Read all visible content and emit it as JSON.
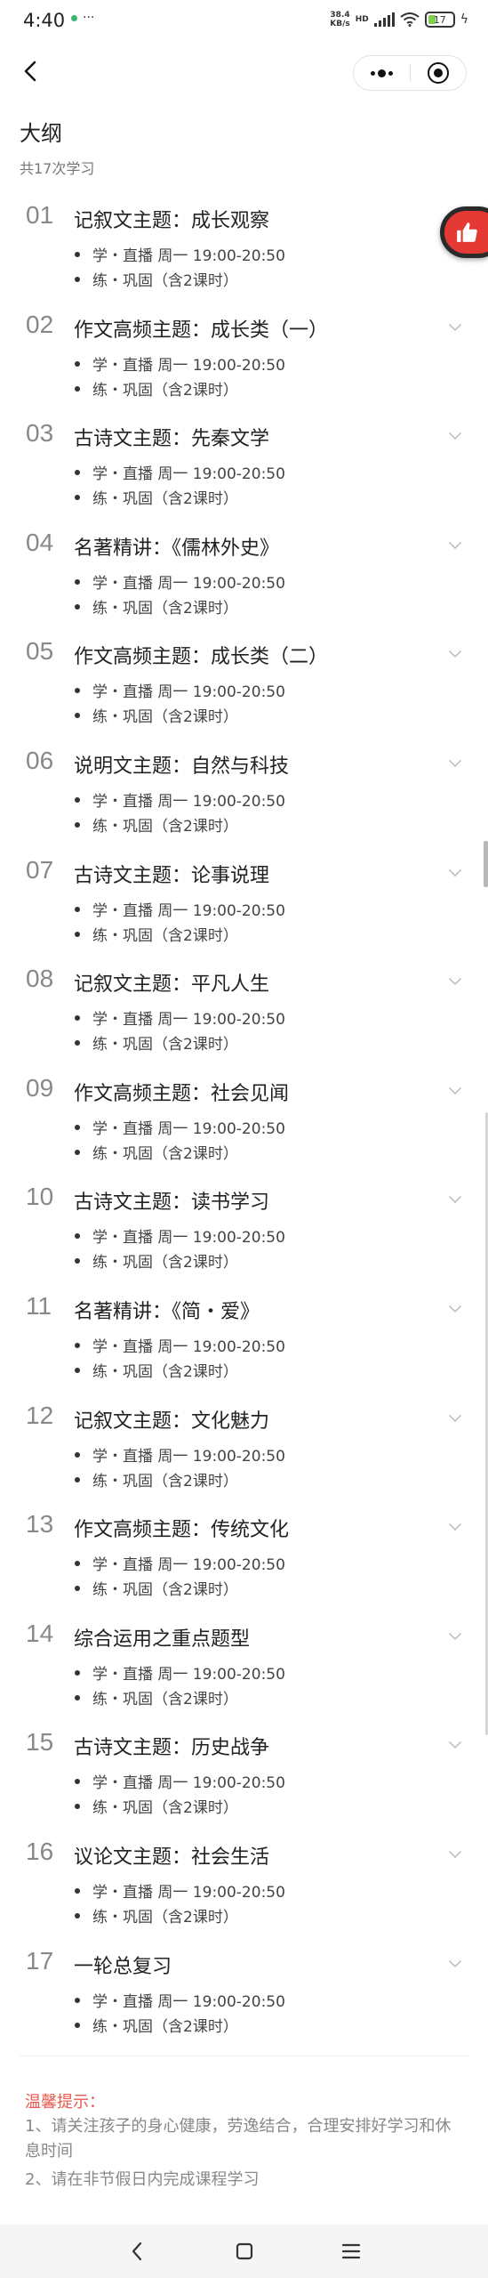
{
  "status_bar": {
    "time": "4:40",
    "extra": "···",
    "net_speed_top": "38.4",
    "net_speed_bottom": "KB/s",
    "net_type": "HD",
    "battery_level": "17"
  },
  "header": {
    "title": "大纲",
    "count": "共17次学习"
  },
  "outline": [
    {
      "num": "01",
      "title": "记叙文主题：成长观察",
      "sub1": "学・直播  周一 19:00-20:50",
      "sub2": "练・巩固（含2课时）"
    },
    {
      "num": "02",
      "title": "作文高频主题：成长类（一）",
      "sub1": "学・直播  周一 19:00-20:50",
      "sub2": "练・巩固（含2课时）"
    },
    {
      "num": "03",
      "title": "古诗文主题：先秦文学",
      "sub1": "学・直播  周一 19:00-20:50",
      "sub2": "练・巩固（含2课时）"
    },
    {
      "num": "04",
      "title": "名著精讲：《儒林外史》",
      "sub1": "学・直播  周一 19:00-20:50",
      "sub2": "练・巩固（含2课时）"
    },
    {
      "num": "05",
      "title": "作文高频主题：成长类（二）",
      "sub1": "学・直播  周一 19:00-20:50",
      "sub2": "练・巩固（含2课时）"
    },
    {
      "num": "06",
      "title": "说明文主题：自然与科技",
      "sub1": "学・直播  周一 19:00-20:50",
      "sub2": "练・巩固（含2课时）"
    },
    {
      "num": "07",
      "title": "古诗文主题：论事说理",
      "sub1": "学・直播  周一 19:00-20:50",
      "sub2": "练・巩固（含2课时）"
    },
    {
      "num": "08",
      "title": "记叙文主题：平凡人生",
      "sub1": "学・直播  周一 19:00-20:50",
      "sub2": "练・巩固（含2课时）"
    },
    {
      "num": "09",
      "title": "作文高频主题：社会见闻",
      "sub1": "学・直播  周一 19:00-20:50",
      "sub2": "练・巩固（含2课时）"
    },
    {
      "num": "10",
      "title": "古诗文主题：读书学习",
      "sub1": "学・直播  周一 19:00-20:50",
      "sub2": "练・巩固（含2课时）"
    },
    {
      "num": "11",
      "title": "名著精讲：《简・爱》",
      "sub1": "学・直播  周一 19:00-20:50",
      "sub2": "练・巩固（含2课时）"
    },
    {
      "num": "12",
      "title": "记叙文主题：文化魅力",
      "sub1": "学・直播  周一 19:00-20:50",
      "sub2": "练・巩固（含2课时）"
    },
    {
      "num": "13",
      "title": "作文高频主题：传统文化",
      "sub1": "学・直播  周一 19:00-20:50",
      "sub2": "练・巩固（含2课时）"
    },
    {
      "num": "14",
      "title": "综合运用之重点题型",
      "sub1": "学・直播  周一 19:00-20:50",
      "sub2": "练・巩固（含2课时）"
    },
    {
      "num": "15",
      "title": "古诗文主题：历史战争",
      "sub1": "学・直播  周一 19:00-20:50",
      "sub2": "练・巩固（含2课时）"
    },
    {
      "num": "16",
      "title": "议论文主题：社会生活",
      "sub1": "学・直播  周一 19:00-20:50",
      "sub2": "练・巩固（含2课时）"
    },
    {
      "num": "17",
      "title": "一轮总复习",
      "sub1": "学・直播  周一 19:00-20:50",
      "sub2": "练・巩固（含2课时）"
    }
  ],
  "tips": {
    "title": "温馨提示：",
    "line1": "1、请关注孩子的身心健康，劳逸结合，合理安排好学习和休息时间",
    "line2": "2、请在非节假日内完成课程学习"
  },
  "colors": {
    "accent_red": "#e53935",
    "tips_red": "#e85a4f",
    "battery_green": "#7ccf4a"
  }
}
